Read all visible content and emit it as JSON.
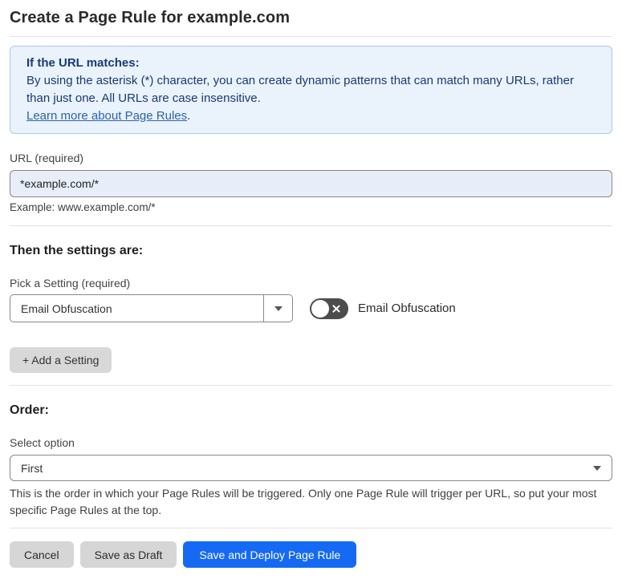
{
  "page": {
    "title": "Create a Page Rule for example.com"
  },
  "info_box": {
    "heading": "If the URL matches:",
    "body": "By using the asterisk (*) character, you can create dynamic patterns that can match many URLs, rather than just one. All URLs are case insensitive.",
    "link_text": "Learn more about Page Rules",
    "link_suffix": "."
  },
  "url_section": {
    "label": "URL (required)",
    "value": "*example.com/*",
    "example": "Example: www.example.com/*"
  },
  "settings_section": {
    "heading": "Then the settings are:",
    "picker_label": "Pick a Setting (required)",
    "picker_value": "Email Obfuscation",
    "toggle_label": "Email Obfuscation",
    "toggle_state": "off",
    "add_button_label": "+ Add a Setting"
  },
  "order_section": {
    "heading": "Order:",
    "select_label": "Select option",
    "select_value": "First",
    "help_text": "This is the order in which your Page Rules will be triggered. Only one Page Rule will trigger per URL, so put your most specific Page Rules at the top."
  },
  "footer": {
    "cancel_label": "Cancel",
    "save_draft_label": "Save as Draft",
    "save_deploy_label": "Save and Deploy Page Rule"
  },
  "icons": {
    "picker_caret": "caret-down",
    "order_caret": "caret-down",
    "toggle_off_glyph": "x-cross"
  },
  "colors": {
    "accent_blue": "#1669f2",
    "info_bg": "#eaf2fc",
    "info_border": "#abcbea",
    "info_text": "#173b73",
    "link_blue": "#2c63ab",
    "autofill_input_bg": "#e7eefa",
    "toggle_off_bg": "#4d4d4d",
    "gray_button_bg": "#d6d6d6",
    "divider": "#e2e2e2"
  }
}
